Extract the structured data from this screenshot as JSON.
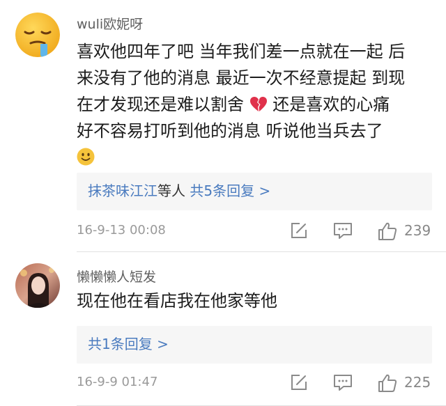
{
  "comments": [
    {
      "username": "wuli欧妮呀",
      "lines": [
        "喜欢他四年了吧 当年我们差一点就在一起 后",
        "来没有了他的消息 最近一次不经意提起 到现",
        "在才发现还是难以割舍",
        "还是喜欢的心痛",
        "好不容易打听到他的消息  听说他当兵去了"
      ],
      "inline_emoji_1": "broken-heart-emoji",
      "inline_emoji_2": "smile-emoji",
      "avatar": "crying-emoji-avatar",
      "replies": {
        "users": "抹茶味江江",
        "mid": "等人",
        "count": "共5条回复 >"
      },
      "timestamp": "16-9-13 00:08",
      "likes": "239"
    },
    {
      "username": "懒懒懒人短发",
      "lines": [
        "现在他在看店我在他家等他"
      ],
      "avatar": "user-photo-avatar",
      "replies": {
        "count": "共1条回复 >"
      },
      "timestamp": "16-9-9 01:47",
      "likes": "225"
    }
  ],
  "icons": {
    "edit": "edit-icon",
    "reply": "comment-icon",
    "like": "thumbs-up-icon"
  },
  "colors": {
    "link": "#4a7bbf",
    "reply_box": "#f6f6f6",
    "emoji_yellow": "#f5b826",
    "broken_heart": "#e0314b"
  }
}
